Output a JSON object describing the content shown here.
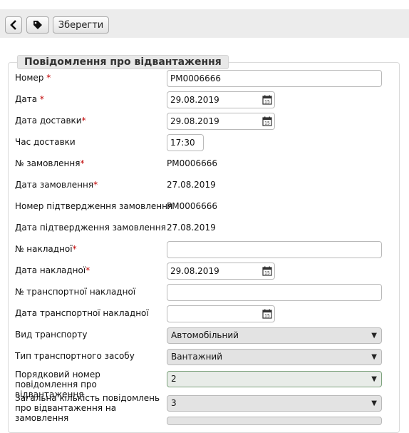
{
  "toolbar": {
    "back_icon": "chevron-left-icon",
    "tag_icon": "tag-icon",
    "save_label": "Зберегти"
  },
  "section": {
    "title": "Повідомлення про відвантаження"
  },
  "form": {
    "number_label": "Номер",
    "number_value": "PM0006666",
    "date_label": "Дата",
    "date_value": "29.08.2019",
    "delivery_date_label": "Дата доставки",
    "delivery_date_value": "29.08.2019",
    "delivery_time_label": "Час доставки",
    "delivery_time_value": "17:30",
    "order_no_label": "№ замовлення",
    "order_no_value": "PM0006666",
    "order_date_label": "Дата замовлення",
    "order_date_value": "27.08.2019",
    "confirm_no_label": "Номер підтвердження замовлення",
    "confirm_no_value": "PM0006666",
    "confirm_date_label": "Дата підтвердження замовлення",
    "confirm_date_value": "27.08.2019",
    "invoice_no_label": "№ накладної",
    "invoice_no_value": "",
    "invoice_date_label": "Дата накладної",
    "invoice_date_value": "29.08.2019",
    "transport_invoice_no_label": "№ транспортної накладної",
    "transport_invoice_no_value": "",
    "transport_invoice_date_label": "Дата транспортної накладної",
    "transport_invoice_date_value": "",
    "transport_type_label": "Вид транспорту",
    "transport_type_value": "Автомобільний",
    "vehicle_type_label": "Тип транспортного засобу",
    "vehicle_type_value": "Вантажний",
    "seq_no_label": "Порядковий номер повідомлення про відвантаження",
    "seq_no_value": "2",
    "total_label": "Загальна кількість повідомлень про відвантаження на замовлення",
    "total_value": "3",
    "required_mark": "*",
    "calendar_icon": "calendar-icon",
    "dropdown_icon": "▼"
  }
}
